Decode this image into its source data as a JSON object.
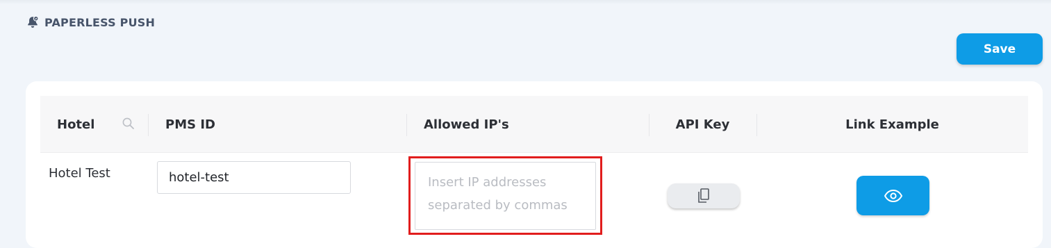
{
  "header": {
    "title": "PAPERLESS PUSH",
    "icon": "bell-icon"
  },
  "toolbar": {
    "save_label": "Save"
  },
  "table": {
    "columns": {
      "hotel": "Hotel",
      "pms_id": "PMS ID",
      "allowed_ips": "Allowed IP's",
      "api_key": "API Key",
      "link_example": "Link Example"
    },
    "rows": [
      {
        "hotel": "Hotel Test",
        "pms_id": "hotel-test",
        "allowed_ips": "",
        "allowed_ips_placeholder": "Insert IP addresses separated by commas",
        "api_key_action_icon": "copy-icon",
        "link_example_action_icon": "eye-icon"
      }
    ]
  },
  "colors": {
    "accent": "#0e9ce6",
    "background": "#f1f5fa",
    "highlight": "#e11d1d"
  }
}
